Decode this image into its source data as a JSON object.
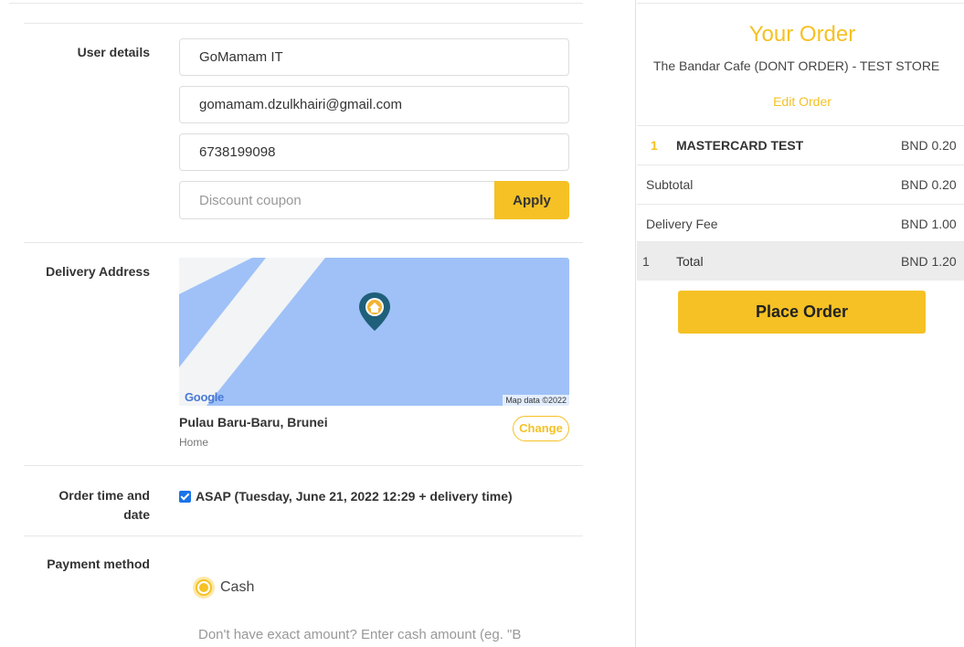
{
  "form": {
    "user_details_label": "User details",
    "name_value": "GoMamam IT",
    "email_value": "gomamam.dzulkhairi@gmail.com",
    "phone_value": "6738199098",
    "coupon_placeholder": "Discount coupon",
    "apply_label": "Apply",
    "delivery_label": "Delivery Address",
    "map_logo": "Google",
    "map_data": "Map data ©2022",
    "address_title": "Pulau Baru-Baru, Brunei",
    "address_sub": "Home",
    "change_label": "Change",
    "order_time_label_1": "Order time and",
    "order_time_label_2": "date",
    "asap_label": "ASAP (Tuesday, June 21, 2022 12:29 + delivery time)",
    "payment_label": "Payment method",
    "cash_label": "Cash",
    "cash_hint": "Don't have exact amount? Enter cash amount (eg. \"B"
  },
  "order": {
    "title": "Your Order",
    "store": "The Bandar Cafe (DONT ORDER) - TEST STORE",
    "edit_label": "Edit Order",
    "item": {
      "qty": "1",
      "name": "MASTERCARD TEST",
      "price": "BND 0.20"
    },
    "subtotal_label": "Subtotal",
    "subtotal_value": "BND 0.20",
    "delivery_fee_label": "Delivery Fee",
    "delivery_fee_value": "BND 1.00",
    "total_qty": "1",
    "total_label": "Total",
    "total_value": "BND 1.20",
    "place_order_label": "Place Order"
  },
  "colors": {
    "accent": "#f5c124",
    "map_water": "#9fc1f7",
    "pin": "#1f5f7a",
    "checkbox": "#1a73e8"
  },
  "icons": {
    "map_pin": "home-map-pin-icon",
    "checkbox": "checkbox-checked-icon",
    "radio": "radio-selected-icon"
  }
}
